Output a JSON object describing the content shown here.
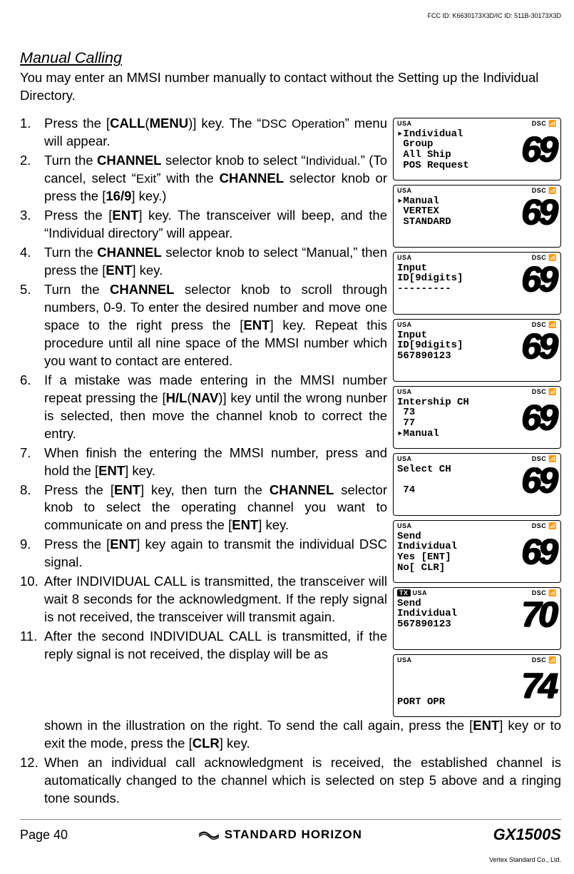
{
  "fcc": "FCC ID: K6630173X3D/IC ID: 511B-30173X3D",
  "section_title": "Manual Calling",
  "intro": "You may enter an MMSI number manually to contact without the Setting up the Individual Directory.",
  "steps": {
    "s1a": "Press the [",
    "s1b": "CALL",
    "s1c": "(",
    "s1d": "MENU",
    "s1e": ")] key. The “",
    "s1f": "DSC Operation",
    "s1g": "” menu will appear.",
    "s2a": "Turn the ",
    "s2b": "CHANNEL",
    "s2c": " selector knob to select “",
    "s2d": "Individual",
    "s2e": ".” (To cancel, select “",
    "s2f": "Exit",
    "s2g": "” with the ",
    "s2h": "CHANNEL",
    "s2i": " selector knob or press the [",
    "s2j": "16/9",
    "s2k": "] key.)",
    "s3a": "Press the [",
    "s3b": "ENT",
    "s3c": "] key. The transceiver will beep, and the “Individual directory” will appear.",
    "s4a": "Turn the ",
    "s4b": "CHANNEL",
    "s4c": " selector knob to select “Manual,” then press the [",
    "s4d": "ENT",
    "s4e": "] key.",
    "s5a": "Turn the ",
    "s5b": "CHANNEL",
    "s5c": " selector knob to scroll through numbers, 0-9. To enter the desired number and move one space to the right press the [",
    "s5d": "ENT",
    "s5e": "] key. Repeat this procedure until all nine space of the MMSI number which you want to contact are entered.",
    "s6a": "If a mistake was made entering in the MMSI number repeat pressing the [",
    "s6b": "H/L",
    "s6c": "(",
    "s6d": "NAV",
    "s6e": ")] key until the wrong nunber is selected, then move the channel knob to correct the entry.",
    "s7a": "When finish the entering the MMSI number, press and hold the [",
    "s7b": "ENT",
    "s7c": "] key.",
    "s8a": "Press the [",
    "s8b": "ENT",
    "s8c": "] key, then turn the ",
    "s8d": "CHANNEL",
    "s8e": " selector knob to select the operating channel you want to communicate on and press the [",
    "s8f": "ENT",
    "s8g": "] key.",
    "s9a": "Press the [",
    "s9b": "ENT",
    "s9c": "] key again to transmit the individual DSC signal.",
    "s10": "After INDIVIDUAL CALL is transmitted, the transceiver will wait 8 seconds for the acknowledgment. If the reply signal is not received, the transceiver will transmit again.",
    "s11a": "After the second INDIVIDUAL CALL is transmitted, if the reply signal is not received, the display will be as",
    "s11b": "shown in the illustration on the right. To send the call again, press the [",
    "s11c": "ENT",
    "s11d": "] key or to exit the mode, press the [",
    "s11e": "CLR",
    "s11f": "] key.",
    "s12": "When an individual call acknowledgment is received, the established channel is automatically changed to the channel which is selected on step 5 above and a ringing tone sounds."
  },
  "screens": [
    {
      "tx": false,
      "usa": "USA",
      "dsc": "DSC",
      "lines": "▸Individual\n Group\n All Ship\n POS Request",
      "ch": "69"
    },
    {
      "tx": false,
      "usa": "USA",
      "dsc": "DSC",
      "lines": "▸Manual\n VERTEX\n STANDARD",
      "ch": "69"
    },
    {
      "tx": false,
      "usa": "USA",
      "dsc": "DSC",
      "lines": "Input\nID[9digits]\n---------",
      "ch": "69"
    },
    {
      "tx": false,
      "usa": "USA",
      "dsc": "DSC",
      "lines": "Input\nID[9digits]\n567890123",
      "ch": "69"
    },
    {
      "tx": false,
      "usa": "USA",
      "dsc": "DSC",
      "lines": "Intership CH\n 73\n 77\n▸Manual",
      "ch": "69"
    },
    {
      "tx": false,
      "usa": "USA",
      "dsc": "DSC",
      "lines": "Select CH\n\n 74",
      "ch": "69"
    },
    {
      "tx": false,
      "usa": "USA",
      "dsc": "DSC",
      "lines": "Send\nIndividual\nYes [ENT]\nNo[ CLR]",
      "ch": "69"
    },
    {
      "tx": true,
      "usa": "USA",
      "dsc": "DSC",
      "lines": "Send\nIndividual\n567890123",
      "ch": "70"
    },
    {
      "tx": false,
      "usa": "USA",
      "dsc": "DSC",
      "lines": "\n\n\nPORT OPR",
      "ch": "74"
    }
  ],
  "footer": {
    "page": "Page 40",
    "brand": "STANDARD HORIZON",
    "model": "GX1500S"
  },
  "vertex": "Vertex Standard Co., Ltd."
}
